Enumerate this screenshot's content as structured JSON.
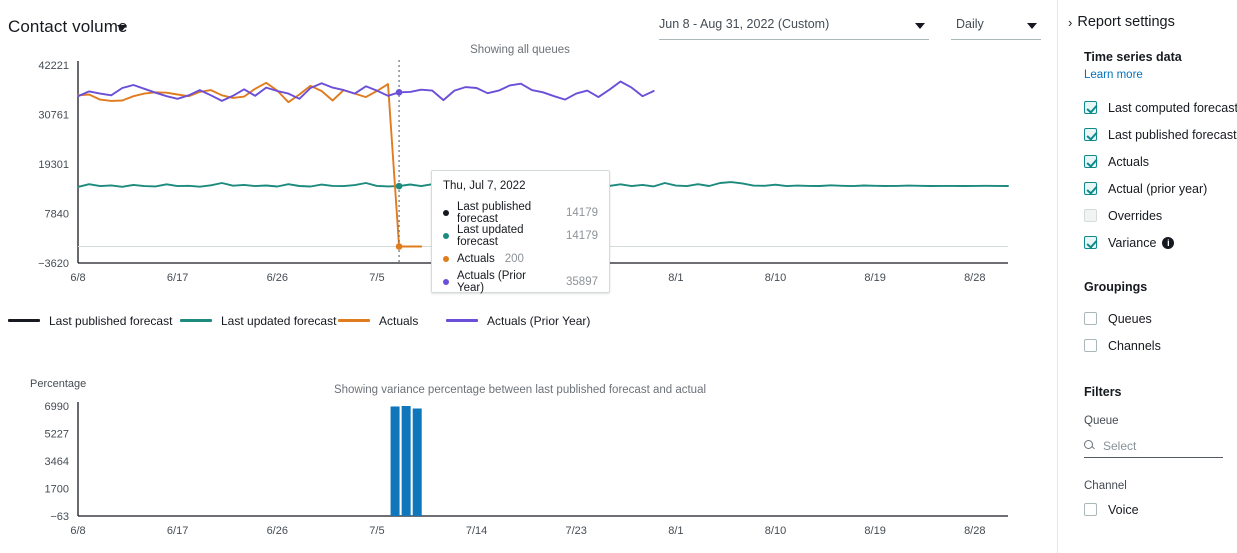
{
  "header": {
    "report_title": "Contact volume",
    "title_caret_icon": "chevron-down-icon",
    "date_range": "Jun 8 - Aug 31, 2022 (Custom)",
    "granularity": "Daily"
  },
  "main": {
    "note_top": "Showing all queues",
    "note_bottom": "Showing variance percentage between last published forecast and actual"
  },
  "tooltip": {
    "date": "Thu, Jul 7, 2022",
    "rows": [
      {
        "label": "Last published forecast",
        "value": "14179",
        "color": "#16191f"
      },
      {
        "label": "Last updated forecast",
        "value": "14179",
        "color": "#1d8a7e"
      },
      {
        "label": "Actuals",
        "value": "200",
        "color": "#e07b1e"
      },
      {
        "label": "Actuals (Prior Year)",
        "value": "35897",
        "color": "#6b4fd8"
      }
    ]
  },
  "legend": [
    {
      "label": "Last published forecast",
      "color": "#16191f"
    },
    {
      "label": "Last updated forecast",
      "color": "#1d8a7e"
    },
    {
      "label": "Actuals",
      "color": "#e07b1e"
    },
    {
      "label": "Actuals (Prior Year)",
      "color": "#6b4fd8"
    }
  ],
  "panel": {
    "chevron_icon": "chevron-right-icon",
    "title": "Report settings",
    "time_series_title": "Time series data",
    "learn_more": "Learn more",
    "time_series_items": [
      {
        "label": "Last computed forecast",
        "checked": true,
        "disabled": false,
        "info": false
      },
      {
        "label": "Last published forecast",
        "checked": true,
        "disabled": false,
        "info": false
      },
      {
        "label": "Actuals",
        "checked": true,
        "disabled": false,
        "info": false
      },
      {
        "label": "Actual (prior year)",
        "checked": true,
        "disabled": false,
        "info": false
      },
      {
        "label": "Overrides",
        "checked": false,
        "disabled": true,
        "info": false
      },
      {
        "label": "Variance",
        "checked": true,
        "disabled": false,
        "info": true,
        "info_icon": "info-icon"
      }
    ],
    "groupings_title": "Groupings",
    "grouping_items": [
      {
        "label": "Queues",
        "checked": false
      },
      {
        "label": "Channels",
        "checked": false
      }
    ],
    "filters_title": "Filters",
    "queue_label": "Queue",
    "queue_search_icon": "search-icon",
    "queue_placeholder": "Select",
    "channel_label": "Channel",
    "channel_items": [
      {
        "label": "Voice",
        "checked": false
      }
    ]
  },
  "chart_data": [
    {
      "id": "contact-volume",
      "type": "line",
      "title": "Contact volume",
      "xlabel": "",
      "ylabel": "",
      "grid": false,
      "legend_position": "bottom",
      "ylim": [
        -3620,
        42221
      ],
      "yticks": [
        42221,
        30761,
        19301,
        7840,
        -3620
      ],
      "xticks": [
        "6/8",
        "6/17",
        "6/26",
        "7/5",
        "7/14",
        "7/23",
        "8/1",
        "8/10",
        "8/19",
        "8/28"
      ],
      "x_start": "6/8/2022",
      "x_end": "8/31/2022",
      "highlight_x_index": 29,
      "highlight_date": "Thu, Jul 7, 2022",
      "series": [
        {
          "name": "Last published forecast",
          "color": "#16191f",
          "values": []
        },
        {
          "name": "Last updated forecast",
          "color": "#1d8a7e",
          "values": [
            14010,
            14620,
            14180,
            14350,
            14020,
            14460,
            14180,
            14120,
            14600,
            14180,
            14260,
            14050,
            14380,
            14900,
            14280,
            14460,
            14180,
            14320,
            14080,
            14620,
            14200,
            14100,
            14520,
            14240,
            14180,
            14420,
            14900,
            14240,
            14120,
            14179,
            14560,
            14180,
            14620,
            14240,
            14900,
            14420,
            14180,
            14700,
            14320,
            14180,
            14560,
            14200,
            14820,
            14300,
            14180,
            14500,
            14180,
            14900,
            14220,
            14600,
            14180,
            14460,
            14120,
            14900,
            14300,
            14180,
            14620,
            14200,
            14900,
            15100,
            14820,
            14300,
            14260,
            14500,
            14180,
            14300,
            14220,
            14200,
            14360,
            14260,
            14180,
            14320,
            14260,
            14200,
            14240,
            14300,
            14260,
            14200,
            14240,
            14220,
            14200,
            14240,
            14260,
            14220,
            14200
          ]
        },
        {
          "name": "Actuals",
          "color": "#e07b1e",
          "values": [
            35200,
            35400,
            34200,
            33900,
            34000,
            35000,
            35600,
            35900,
            35800,
            35400,
            35000,
            36000,
            36400,
            35200,
            34600,
            34900,
            36700,
            38100,
            36300,
            33600,
            35400,
            37400,
            36200,
            34000,
            36400,
            35600,
            34800,
            36200,
            37800,
            200,
            200,
            200,
            null,
            null,
            null,
            null,
            null,
            null,
            null,
            null,
            null,
            null,
            null,
            null,
            null,
            null,
            null,
            null,
            null,
            null,
            null,
            null,
            null,
            null,
            null,
            null,
            null,
            null,
            null,
            null,
            null,
            null,
            null,
            null,
            null,
            null,
            null,
            null,
            null,
            null,
            null,
            null,
            null,
            null,
            null,
            null,
            null,
            null,
            null,
            null,
            null,
            null,
            null,
            null,
            null
          ]
        },
        {
          "name": "Actuals (Prior Year)",
          "color": "#6b4fd8",
          "values": [
            35000,
            36100,
            35600,
            35200,
            36900,
            37600,
            36700,
            35800,
            35000,
            34400,
            35200,
            36400,
            35200,
            33900,
            35100,
            36600,
            35100,
            37000,
            36200,
            35600,
            34400,
            36900,
            38000,
            37000,
            36400,
            35600,
            37300,
            36300,
            35100,
            35897,
            36000,
            36500,
            36300,
            34100,
            36300,
            37100,
            36900,
            35700,
            36300,
            37500,
            37900,
            36400,
            35900,
            35000,
            34200,
            35600,
            36300,
            34800,
            36500,
            38400,
            37000,
            35000,
            36200,
            null,
            null,
            null,
            null,
            null,
            null,
            null,
            null,
            null,
            null,
            null,
            null,
            null,
            null,
            null,
            null,
            null,
            null,
            null,
            null,
            null,
            null,
            null,
            null,
            null,
            null,
            null,
            null,
            null,
            null,
            null,
            null
          ]
        }
      ]
    },
    {
      "id": "variance-percentage",
      "type": "bar",
      "title": "Showing variance percentage between last published forecast and actual",
      "axis_caption": "Percentage",
      "xlabel": "",
      "ylabel": "Percentage",
      "grid": false,
      "ylim": [
        -63,
        6990
      ],
      "yticks": [
        6990,
        5227,
        3464,
        1700,
        -63
      ],
      "xticks": [
        "6/8",
        "6/17",
        "6/26",
        "7/5",
        "7/14",
        "7/23",
        "8/1",
        "8/10",
        "8/19",
        "8/28"
      ],
      "bar_color": "#1076bc",
      "categories": [
        "7/6",
        "7/7",
        "7/8"
      ],
      "values": [
        6960,
        6990,
        6830
      ]
    }
  ]
}
